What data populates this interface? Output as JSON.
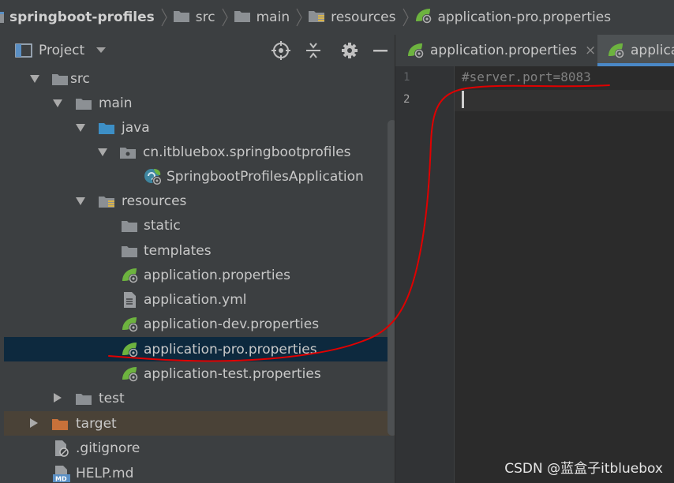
{
  "breadcrumb": [
    {
      "label": "springboot-profiles",
      "icon": "module-icon"
    },
    {
      "label": "src",
      "icon": "folder-icon"
    },
    {
      "label": "main",
      "icon": "folder-icon"
    },
    {
      "label": "resources",
      "icon": "resources-folder-icon"
    },
    {
      "label": "application-pro.properties",
      "icon": "spring-properties-icon"
    }
  ],
  "project_panel": {
    "title": "Project",
    "tools": [
      "locate-icon",
      "collapse-all-icon",
      "settings-icon",
      "hide-icon"
    ]
  },
  "tree": [
    {
      "label": "src",
      "icon": "folder",
      "expanded": true
    },
    {
      "label": "main",
      "icon": "folder",
      "expanded": true
    },
    {
      "label": "java",
      "icon": "source-folder",
      "expanded": true
    },
    {
      "label": "cn.itbluebox.springbootprofiles",
      "icon": "package",
      "expanded": true
    },
    {
      "label": "SpringbootProfilesApplication",
      "icon": "spring-boot-class"
    },
    {
      "label": "resources",
      "icon": "resources-folder",
      "expanded": true
    },
    {
      "label": "static",
      "icon": "folder"
    },
    {
      "label": "templates",
      "icon": "folder"
    },
    {
      "label": "application.properties",
      "icon": "spring-properties"
    },
    {
      "label": "application.yml",
      "icon": "yml-file"
    },
    {
      "label": "application-dev.properties",
      "icon": "spring-properties"
    },
    {
      "label": "application-pro.properties",
      "icon": "spring-properties",
      "selected": true
    },
    {
      "label": "application-test.properties",
      "icon": "spring-properties"
    },
    {
      "label": "test",
      "icon": "folder",
      "expanded": false
    },
    {
      "label": "target",
      "icon": "excluded-folder",
      "expanded": false
    },
    {
      "label": ".gitignore",
      "icon": "gitignore-file"
    },
    {
      "label": "HELP.md",
      "icon": "markdown-file"
    }
  ],
  "tabs": [
    {
      "label": "application.properties",
      "close": "×",
      "active": false
    },
    {
      "label": "applica",
      "active": true
    }
  ],
  "editor": {
    "lines": [
      {
        "number": "1",
        "text": "#server.port=8083"
      },
      {
        "number": "2",
        "text": ""
      }
    ]
  },
  "watermark": "CSDN @蓝盒子itbluebox",
  "colors": {
    "panel_bg": "#3c3f41",
    "editor_bg": "#2b2b2b",
    "selection": "#0d293e",
    "spring_green": "#6db33f",
    "folder": "#8c9094",
    "source_folder": "#3d8fc6",
    "excluded_folder": "#c8713a",
    "tab_accent": "#4a88c7",
    "annotation_red": "#e00000"
  }
}
